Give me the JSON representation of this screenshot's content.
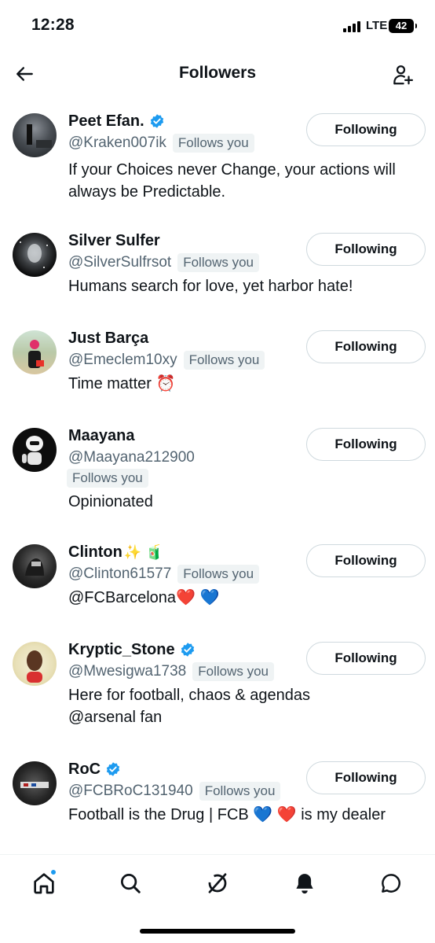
{
  "status_bar": {
    "time": "12:28",
    "network": "LTE",
    "battery": "42"
  },
  "header": {
    "title": "Followers",
    "back_icon": "arrow-left-icon",
    "add_icon": "person-plus-icon"
  },
  "follows_you_label": "Follows you",
  "colors": {
    "verified": "#1d9bf0",
    "secondary_text": "#536471",
    "badge_bg": "#eff3f4",
    "button_border": "#cfd9de",
    "notification_dot": "#1d9bf0"
  },
  "followers": [
    {
      "name": "Peet Efan.",
      "name_emoji": "",
      "verified": true,
      "handle": "@Kraken007ik",
      "follows_you": "Follows you",
      "bio_lines": [
        "If your Choices never Change, your actions will",
        "always be Predictable."
      ],
      "button": "Following"
    },
    {
      "name": "Silver Sulfer",
      "name_emoji": "",
      "verified": false,
      "handle": "@SilverSulfrsot",
      "follows_you": "Follows you",
      "bio_lines": [
        "Humans search for love, yet harbor hate!"
      ],
      "button": "Following"
    },
    {
      "name": "Just Barça",
      "name_emoji": "",
      "verified": false,
      "handle": "@Emeclem10xy",
      "follows_you": "Follows you",
      "bio_lines": [
        "Time matter ⏰"
      ],
      "button": "Following"
    },
    {
      "name": "Maayana",
      "name_emoji": "",
      "verified": false,
      "handle": "@Maayana212900",
      "follows_you": "Follows you",
      "bio_lines": [
        "Opinionated"
      ],
      "button": "Following"
    },
    {
      "name": "Clinton",
      "name_emoji": "✨ 🧃",
      "verified": false,
      "handle": "@Clinton61577",
      "follows_you": "Follows you",
      "bio_lines": [
        "@FCBarcelona❤️ 💙"
      ],
      "button": "Following"
    },
    {
      "name": "Kryptic_Stone",
      "name_emoji": "",
      "verified": true,
      "handle": "@Mwesigwa1738",
      "follows_you": "Follows you",
      "bio_lines": [
        "Here for football, chaos & agendas",
        "@arsenal fan"
      ],
      "button": "Following"
    },
    {
      "name": "RoC",
      "name_emoji": "",
      "verified": true,
      "handle": "@FCBRoC131940",
      "follows_you": "Follows you",
      "bio_lines": [
        "Football is the Drug | FCB 💙 ❤️  is my dealer"
      ],
      "button": "Following"
    }
  ],
  "bottom_nav": [
    {
      "icon": "home-icon",
      "has_dot": true
    },
    {
      "icon": "search-icon",
      "has_dot": false
    },
    {
      "icon": "grok-icon",
      "has_dot": false
    },
    {
      "icon": "bell-icon",
      "has_dot": false
    },
    {
      "icon": "messages-icon",
      "has_dot": false
    }
  ]
}
